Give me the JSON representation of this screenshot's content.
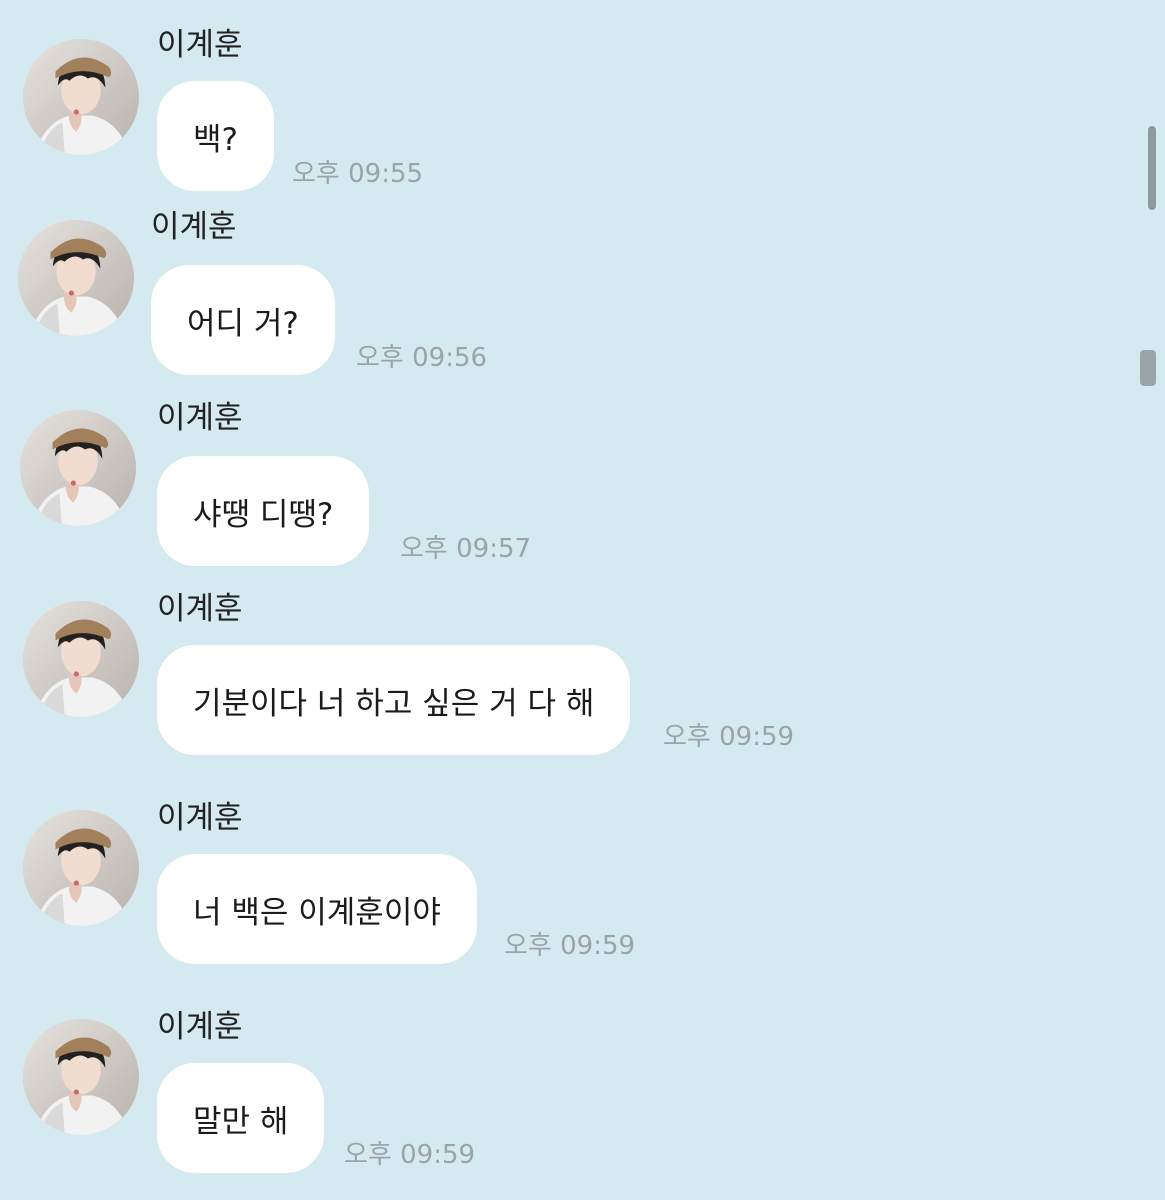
{
  "messages": [
    {
      "sender": "이계훈",
      "text": "백?",
      "time": "오후 09:55"
    },
    {
      "sender": "이계훈",
      "text": "어디 거?",
      "time": "오후 09:56"
    },
    {
      "sender": "이계훈",
      "text": "샤땡 디땡?",
      "time": "오후 09:57"
    },
    {
      "sender": "이계훈",
      "text": "기분이다 너 하고 싶은 거 다 해",
      "time": "오후 09:59"
    },
    {
      "sender": "이계훈",
      "text": "너 백은 이계훈이야",
      "time": "오후 09:59"
    },
    {
      "sender": "이계훈",
      "text": "말만 해",
      "time": "오후 09:59"
    }
  ],
  "colors": {
    "background": "#d5eaf0",
    "bubble": "#ffffff",
    "time": "#9aa4a8",
    "scrollbar": "#8f9a9e"
  },
  "icons": {
    "avatar": "profile-photo"
  }
}
